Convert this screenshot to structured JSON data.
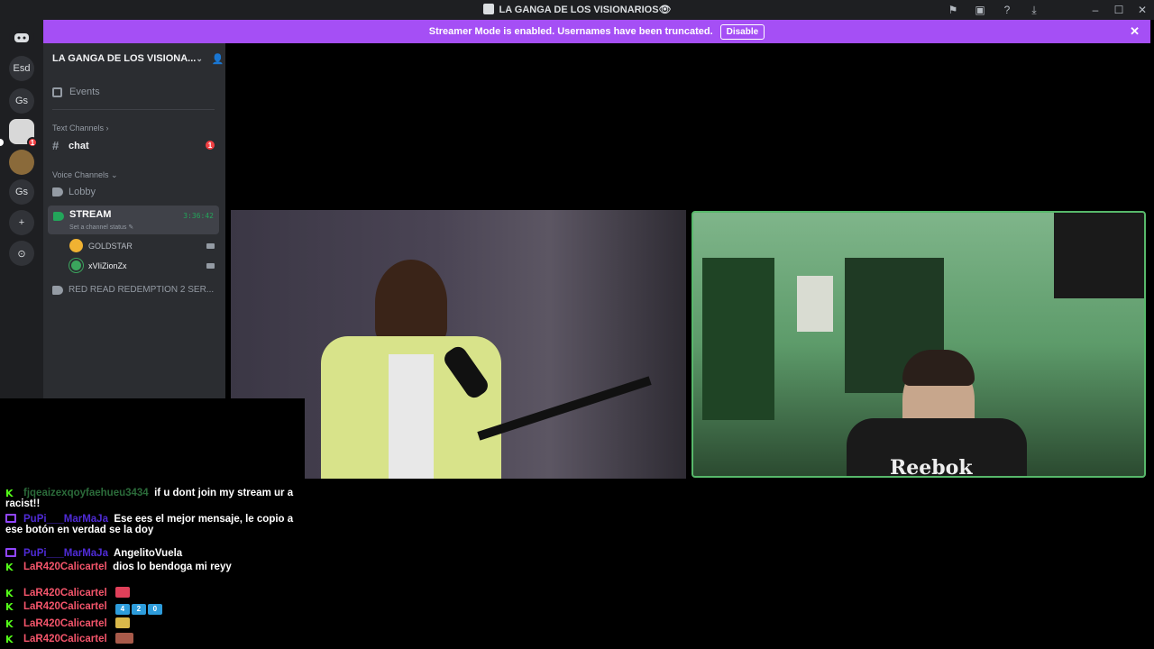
{
  "window": {
    "title": "LA GANGA DE LOS VISIONARIOS👁"
  },
  "banner": {
    "message": "Streamer Mode is enabled. Usernames have been truncated.",
    "disable_label": "Disable",
    "close_glyph": "✕"
  },
  "rail": {
    "items": [
      {
        "name": "discord-home-icon",
        "label": ""
      },
      {
        "name": "server-esd",
        "label": "Esd"
      },
      {
        "name": "server-gs-1",
        "label": "Gs"
      },
      {
        "name": "server-ganga",
        "label": "",
        "badge": "1"
      },
      {
        "name": "server-avatar",
        "label": ""
      },
      {
        "name": "server-gs-2",
        "label": "Gs"
      },
      {
        "name": "add-server-icon",
        "label": "+"
      },
      {
        "name": "explore-icon",
        "label": "⊙"
      }
    ]
  },
  "sidebar": {
    "server_name": "LA GANGA DE LOS VISIONA...",
    "events_label": "Events",
    "text_category": "Text Channels ›",
    "chat_channel": "chat",
    "chat_badge": "1",
    "voice_category": "Voice Channels ⌄",
    "lobby": "Lobby",
    "stream": {
      "name": "STREAM",
      "status": "Set a channel status ✎",
      "timer": "3:36:42"
    },
    "members": [
      {
        "name": "GOLDSTAR",
        "color": "#f0b232"
      },
      {
        "name": "xVIiZionZx",
        "color": "#3ba55d"
      }
    ],
    "rdr_channel": "RED READ REDEMPTION 2 SER..."
  },
  "videos": {
    "right_logo": "Reebok"
  },
  "chat": [
    {
      "platform": "kick",
      "user": "fjqeaizexqoyfaehueu3434",
      "user_class": "u-green",
      "text": "if u dont join my stream ur a racist!!"
    },
    {
      "platform": "twitch",
      "user": "PuPi___MarMaJa",
      "user_class": "u-blue",
      "text": "Ese ees el mejor mensaje, le copio a ese botón en verdad se la doy"
    },
    {
      "platform": "twitch",
      "user": "PuPi___MarMaJa",
      "user_class": "u-blue",
      "text": "AngelitoVuela"
    },
    {
      "platform": "kick",
      "user": "LaR420Calicartel",
      "user_class": "u-red",
      "text": "dios lo bendoga mi reyy"
    },
    {
      "platform": "kick",
      "user": "LaR420Calicartel",
      "user_class": "u-red",
      "text": ""
    },
    {
      "platform": "kick",
      "user": "LaR420Calicartel",
      "user_class": "u-red",
      "text": ""
    },
    {
      "platform": "kick",
      "user": "LaR420Calicartel",
      "user_class": "u-red",
      "text": ""
    },
    {
      "platform": "kick",
      "user": "LaR420Calicartel",
      "user_class": "u-red",
      "text": ""
    }
  ],
  "emotes": {
    "row5": [
      "#e0405a"
    ],
    "row6": [
      "#2d9cdb",
      "#2d9cdb",
      "#2d9cdb"
    ],
    "row6_text": [
      "4",
      "2",
      "0"
    ],
    "row7": [
      "#d9b84a"
    ],
    "row8": [
      "#a85a4a"
    ]
  },
  "colors": {
    "accent": "#a54ff5",
    "kick": "#53fc18",
    "twitch": "#9146ff",
    "voice_green": "#23a55a"
  }
}
